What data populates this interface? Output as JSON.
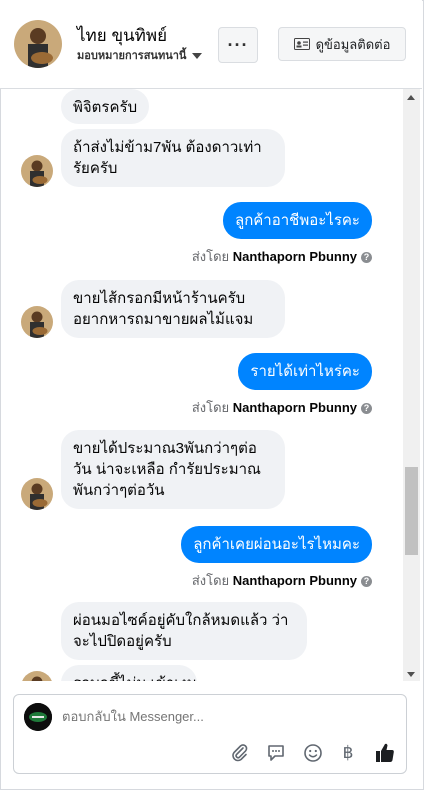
{
  "header": {
    "name": "ไทย ขุนทิพย์",
    "subtitle": "มอบหมายการสนทนานี้",
    "more_label": "···",
    "contact_label": "ดูข้อมูลติดต่อ"
  },
  "messages": [
    {
      "direction": "in",
      "text": "พิจิตรครับ"
    },
    {
      "direction": "in",
      "text": "ถ้าส่งไม่ข้าม7พัน ต้องดาวเท่ารัยครับ"
    },
    {
      "direction": "out",
      "text": "ลูกค้าอาชีพอะไรคะ"
    },
    {
      "direction": "in",
      "text": "ขายไส้กรอกมีหน้าร้านครับ อยากหารถมาขายผลไม้แจม"
    },
    {
      "direction": "out",
      "text": "รายได้เท่าไหร่คะ"
    },
    {
      "direction": "in",
      "text": "ขายได้ประมาณ3พันกว่าๆต่อวัน น่าจะเหลือ กำรัยประมาณพันกว่าๆต่อวัน"
    },
    {
      "direction": "out",
      "text": "ลูกค้าเคยผ่อนอะไรไหมคะ"
    },
    {
      "direction": "in",
      "text": "ผ่อนมอไซค์อยู่คับใกล้หมดแล้ว ว่าจะไปปิดอยู่ครับ"
    },
    {
      "direction": "in",
      "text": "รถบกขี้ไม่ม เข้าเงนแ"
    }
  ],
  "sent_by": {
    "prefix": "ส่งโดย",
    "agent": "Nanthaporn Pbunny",
    "help": "?"
  },
  "composer": {
    "placeholder": "ตอบกลับใน Messenger..."
  },
  "toolbar": {
    "icons": [
      "paperclip-icon",
      "saved-reply-icon",
      "emoji-icon",
      "baht-icon",
      "thumbs-up-icon"
    ],
    "baht_glyph": "฿"
  },
  "colors": {
    "outgoing_bubble": "#0084ff",
    "incoming_bubble": "#f0f2f5",
    "like_icon": "#1c1e21"
  }
}
